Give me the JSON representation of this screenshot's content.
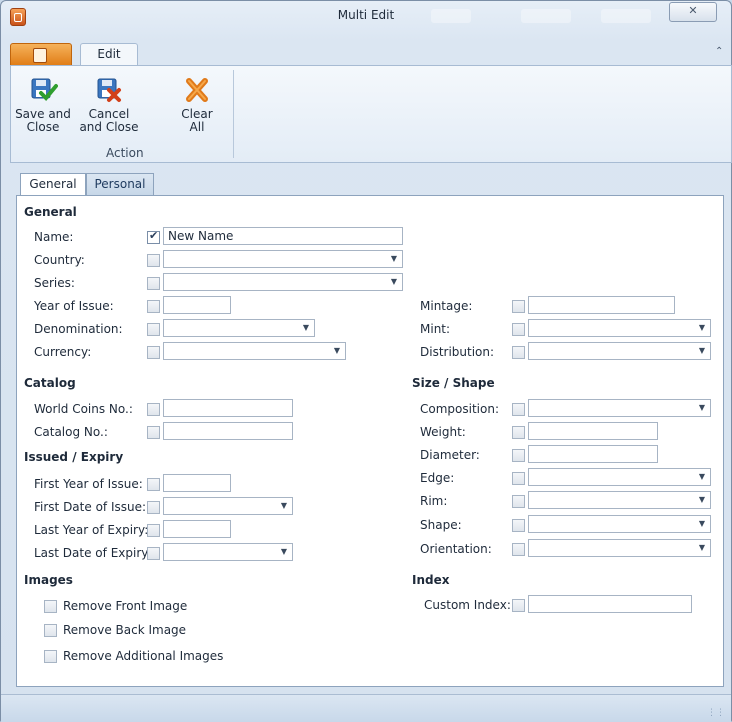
{
  "window": {
    "title": "Multi Edit",
    "close_glyph": "✕"
  },
  "ribbon": {
    "tab_label": "Edit",
    "buttons": [
      {
        "label": "Save and\nClose",
        "icon": "save-close-icon"
      },
      {
        "label": "Cancel\nand Close",
        "icon": "cancel-close-icon"
      },
      {
        "label": "Clear\nAll",
        "icon": "clear-all-icon"
      }
    ],
    "group_label": "Action"
  },
  "tabs": [
    "General",
    "Personal"
  ],
  "sections": {
    "general": "General",
    "catalog": "Catalog",
    "issued_expiry": "Issued / Expiry",
    "images": "Images",
    "size_shape": "Size / Shape",
    "index": "Index"
  },
  "fields": {
    "name": {
      "label": "Name:",
      "checked": true,
      "value": "New Name"
    },
    "country": {
      "label": "Country:"
    },
    "series": {
      "label": "Series:"
    },
    "year_of_issue": {
      "label": "Year of Issue:"
    },
    "denomination": {
      "label": "Denomination:"
    },
    "currency": {
      "label": "Currency:"
    },
    "mintage": {
      "label": "Mintage:"
    },
    "mint": {
      "label": "Mint:"
    },
    "distribution": {
      "label": "Distribution:"
    },
    "world_coins_no": {
      "label": "World Coins No.:"
    },
    "catalog_no": {
      "label": "Catalog No.:"
    },
    "first_year_of_issue": {
      "label": "First Year of Issue:"
    },
    "first_date_of_issue": {
      "label": "First Date of Issue:"
    },
    "last_year_of_expiry": {
      "label": "Last Year of Expiry:"
    },
    "last_date_of_expiry": {
      "label": "Last Date of Expiry:"
    },
    "composition": {
      "label": "Composition:"
    },
    "weight": {
      "label": "Weight:"
    },
    "diameter": {
      "label": "Diameter:"
    },
    "edge": {
      "label": "Edge:"
    },
    "rim": {
      "label": "Rim:"
    },
    "shape": {
      "label": "Shape:"
    },
    "orientation": {
      "label": "Orientation:"
    },
    "custom_index": {
      "label": "Custom Index:"
    }
  },
  "images": {
    "remove_front": "Remove Front Image",
    "remove_back": "Remove Back Image",
    "remove_additional": "Remove Additional Images"
  }
}
